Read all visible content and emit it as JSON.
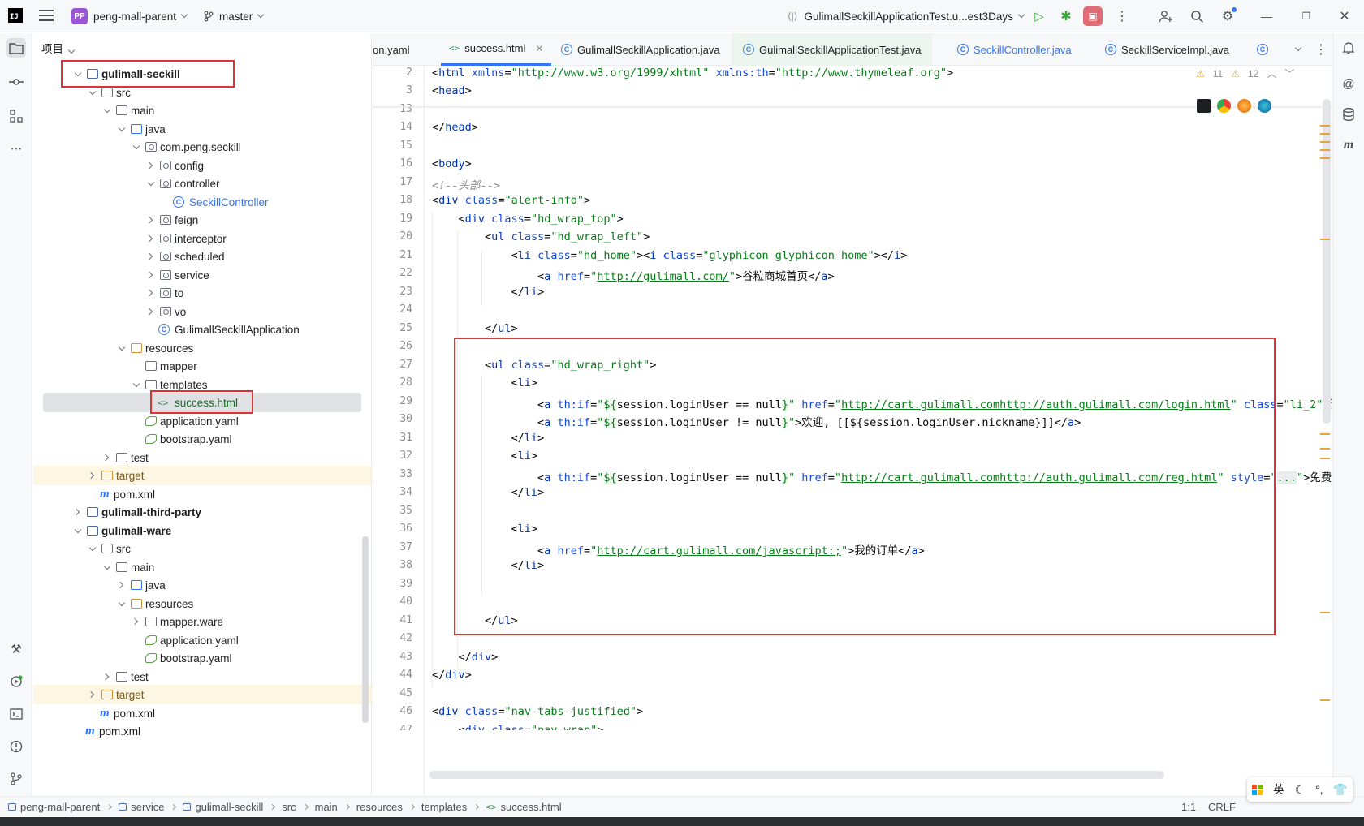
{
  "titlebar": {
    "logo": "IJ",
    "project_badge": "PP",
    "project_name": "peng-mall-parent",
    "branch": "master",
    "run_config": "GulimallSeckillApplicationTest.u...est3Days"
  },
  "project_panel": {
    "title": "项目",
    "rows": [
      {
        "label": "gulimall-seckill"
      },
      {
        "label": "src"
      },
      {
        "label": "main"
      },
      {
        "label": "java"
      },
      {
        "label": "com.peng.seckill"
      },
      {
        "label": "config"
      },
      {
        "label": "controller"
      },
      {
        "label": "SeckillController"
      },
      {
        "label": "feign"
      },
      {
        "label": "interceptor"
      },
      {
        "label": "scheduled"
      },
      {
        "label": "service"
      },
      {
        "label": "to"
      },
      {
        "label": "vo"
      },
      {
        "label": "GulimallSeckillApplication"
      },
      {
        "label": "resources"
      },
      {
        "label": "mapper"
      },
      {
        "label": "templates"
      },
      {
        "label": "success.html"
      },
      {
        "label": "application.yaml"
      },
      {
        "label": "bootstrap.yaml"
      },
      {
        "label": "test"
      },
      {
        "label": "target"
      },
      {
        "label": "pom.xml"
      },
      {
        "label": "gulimall-third-party"
      },
      {
        "label": "gulimall-ware"
      },
      {
        "label": "src"
      },
      {
        "label": "main"
      },
      {
        "label": "java"
      },
      {
        "label": "resources"
      },
      {
        "label": "mapper.ware"
      },
      {
        "label": "application.yaml"
      },
      {
        "label": "bootstrap.yaml"
      },
      {
        "label": "test"
      },
      {
        "label": "target"
      },
      {
        "label": "pom.xml"
      },
      {
        "label": "pom.xml"
      }
    ]
  },
  "tabs": [
    {
      "label": "on.yaml"
    },
    {
      "label": "success.html"
    },
    {
      "label": "GulimallSeckillApplication.java"
    },
    {
      "label": "GulimallSeckillApplicationTest.java"
    },
    {
      "label": "SeckillController.java"
    },
    {
      "label": "SeckillServiceImpl.java"
    }
  ],
  "inspections": {
    "warnings": "11",
    "weak_warnings": "12"
  },
  "editor": {
    "lines": [
      "2",
      "3",
      "13",
      "14",
      "15",
      "16",
      "17",
      "18",
      "19",
      "20",
      "21",
      "22",
      "23",
      "24",
      "25",
      "26",
      "27",
      "28",
      "29",
      "30",
      "31",
      "32",
      "33",
      "34",
      "35",
      "36",
      "37",
      "38",
      "39",
      "40",
      "41",
      "42",
      "43",
      "44",
      "45",
      "46",
      "47"
    ]
  },
  "statusbar": {
    "crumbs": [
      "peng-mall-parent",
      "service",
      "gulimall-seckill",
      "src",
      "main",
      "resources",
      "templates",
      "success.html"
    ],
    "position": "1:1",
    "line_ending": "CRLF"
  },
  "ime": {
    "lang": "英",
    "punct": "°,"
  }
}
